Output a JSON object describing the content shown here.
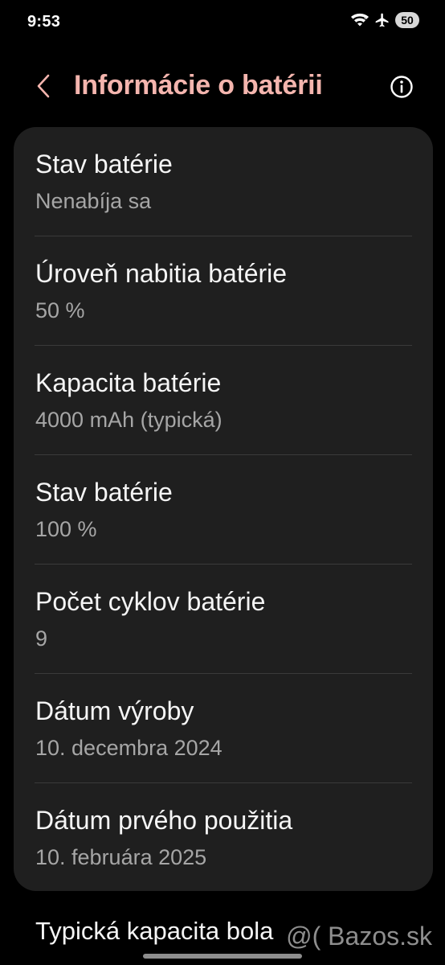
{
  "status_bar": {
    "time": "9:53",
    "battery": "50",
    "icons": [
      "wifi-icon",
      "airplane-icon",
      "battery-indicator"
    ]
  },
  "header": {
    "title": "Informácie o batérii",
    "back_icon": "chevron-left-icon",
    "info_icon": "info-circle-icon",
    "title_color": "#f4b5ae"
  },
  "items": [
    {
      "title": "Stav batérie",
      "value": "Nenabíja sa"
    },
    {
      "title": "Úroveň nabitia batérie",
      "value": "50 %"
    },
    {
      "title": "Kapacita batérie",
      "value": "4000 mAh (typická)"
    },
    {
      "title": "Stav batérie",
      "value": "100 %"
    },
    {
      "title": "Počet cyklov batérie",
      "value": "9"
    },
    {
      "title": "Dátum výroby",
      "value": "10. decembra 2024"
    },
    {
      "title": "Dátum prvého použitia",
      "value": "10. februára 2025"
    }
  ],
  "footer": {
    "text": "Typická kapacita bola"
  },
  "watermark": "@( Bazos.sk"
}
